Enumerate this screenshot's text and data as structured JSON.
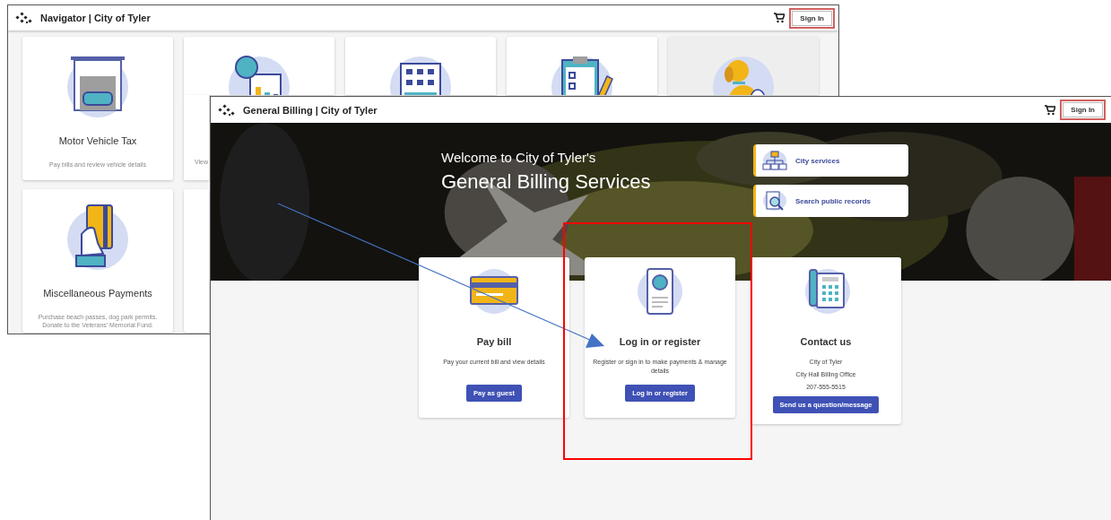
{
  "back_window": {
    "title": "Navigator | City of Tyler",
    "sign_in": "Sign In",
    "tiles": [
      {
        "title": "Motor Vehicle Tax",
        "description": "Pay bills and review vehicle details",
        "selected": false
      },
      {
        "description": "View",
        "selected": false
      },
      {
        "selected": false
      },
      {
        "selected": false
      },
      {
        "selected": true
      },
      {
        "title": "Miscellaneous Payments",
        "description": "Purchase beach passes, dog park permits. Donate to the Veterans' Memorial Fund.",
        "selected": false
      },
      {
        "selected": false
      }
    ]
  },
  "front_window": {
    "title": "General Billing | City of Tyler",
    "sign_in": "Sign In",
    "hero": {
      "greeting": "Welcome to City of Tyler's",
      "heading": "General Billing Services",
      "links": [
        {
          "label": "City services"
        },
        {
          "label": "Search public records"
        }
      ]
    },
    "cards": [
      {
        "title": "Pay bill",
        "lines": [
          "Pay your current bill and view details"
        ],
        "button": "Pay as guest"
      },
      {
        "title": "Log in or register",
        "lines": [
          "Register or sign in to make payments & manage details"
        ],
        "button": "Log in or register"
      },
      {
        "title": "Contact us",
        "lines": [
          "City of Tyler",
          "City Hall Billing Office",
          "207-555-5515"
        ],
        "button": "Send us a question/message"
      }
    ]
  },
  "annotations": [
    {
      "kind": "arrow"
    },
    {
      "kind": "highlight-box"
    }
  ]
}
